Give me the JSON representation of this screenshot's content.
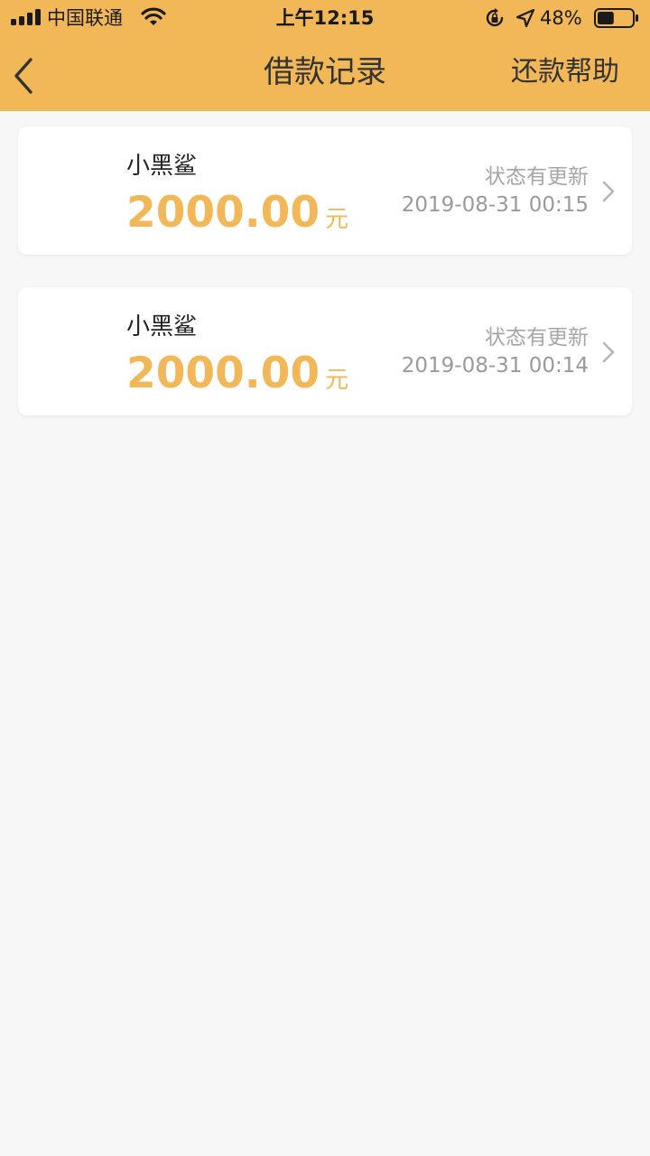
{
  "status_bar": {
    "carrier": "中国联通",
    "time": "上午12:15",
    "battery": "48%",
    "battery_level": 0.48
  },
  "nav": {
    "title": "借款记录",
    "help_label": "还款帮助"
  },
  "records": [
    {
      "name": "小黑鲨",
      "amount": "2000.00",
      "unit": "元",
      "status": "状态有更新",
      "time": "2019-08-31 00:15"
    },
    {
      "name": "小黑鲨",
      "amount": "2000.00",
      "unit": "元",
      "status": "状态有更新",
      "time": "2019-08-31 00:14"
    }
  ],
  "colors": {
    "accent": "#f2b858",
    "background": "#f7f7f7",
    "card": "#ffffff",
    "muted_text": "#a6a6a6"
  },
  "icons": {
    "back": "chevron-left-icon",
    "row_arrow": "chevron-right-icon"
  }
}
